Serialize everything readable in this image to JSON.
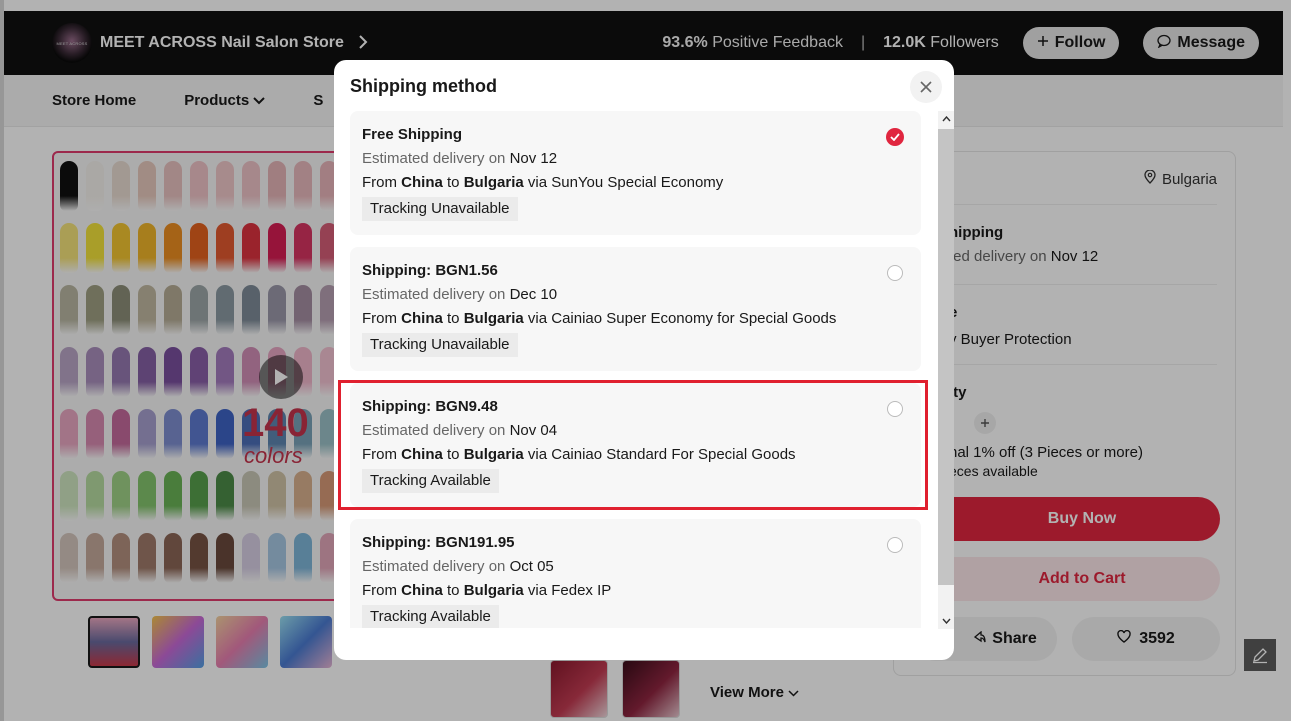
{
  "store": {
    "logo_text": "MEET ACROSS",
    "name": "MEET ACROSS Nail Salon Store",
    "feedback_value": "93.6%",
    "feedback_label": "Positive Feedback",
    "followers_value": "12.0K",
    "followers_label": "Followers",
    "separator": "|",
    "follow_label": "Follow",
    "message_label": "Message"
  },
  "nav": {
    "store_home": "Store Home",
    "products": "Products",
    "sale": "S"
  },
  "gallery": {
    "promo_number": "140",
    "promo_text": "colors"
  },
  "side_panel": {
    "ship_to": "Bulgaria",
    "shipping_partial": "hipping",
    "shipping_delivery_partial": "ted delivery on",
    "shipping_delivery_date": "Nov 12",
    "service_partial": "e",
    "service_text": "y Buyer Protection",
    "quantity_partial": "ity",
    "discount_text": "nal 1% off (3 Pieces or more)",
    "availability_text": "eces available",
    "buy_now": "Buy Now",
    "add_to_cart": "Add to Cart",
    "share": "Share",
    "wishlist_count": "3592"
  },
  "view_more": "View More",
  "modal": {
    "title": "Shipping method",
    "options": [
      {
        "title": "Free Shipping",
        "est_prefix": "Estimated delivery on",
        "date": "Nov 12",
        "from_label": "From",
        "from": "China",
        "to_label": "to",
        "to": "Bulgaria",
        "via": "via SunYou Special Economy",
        "tracking": "Tracking Unavailable",
        "selected": true
      },
      {
        "title": "Shipping: BGN1.56",
        "est_prefix": "Estimated delivery on",
        "date": "Dec 10",
        "from_label": "From",
        "from": "China",
        "to_label": "to",
        "to": "Bulgaria",
        "via": "via Cainiao Super Economy for Special Goods",
        "tracking": "Tracking Unavailable",
        "selected": false
      },
      {
        "title": "Shipping: BGN9.48",
        "est_prefix": "Estimated delivery on",
        "date": "Nov 04",
        "from_label": "From",
        "from": "China",
        "to_label": "to",
        "to": "Bulgaria",
        "via": "via Cainiao Standard For Special Goods",
        "tracking": "Tracking Available",
        "selected": false
      },
      {
        "title": "Shipping: BGN191.95",
        "est_prefix": "Estimated delivery on",
        "date": "Oct 05",
        "from_label": "From",
        "from": "China",
        "to_label": "to",
        "to": "Bulgaria",
        "via": "via Fedex IP",
        "tracking": "Tracking Available",
        "selected": false
      }
    ]
  },
  "colors": {
    "header_bg": "#111111",
    "accent_red": "#e0263f",
    "highlight_red": "#e0202f",
    "gallery_border": "#e03c6e"
  },
  "icons": {
    "close": "close-icon",
    "check": "check-icon",
    "location": "location-pin-icon",
    "chevron": "chevron-right-icon",
    "heart": "heart-icon",
    "share": "share-icon",
    "edit": "edit-icon"
  }
}
